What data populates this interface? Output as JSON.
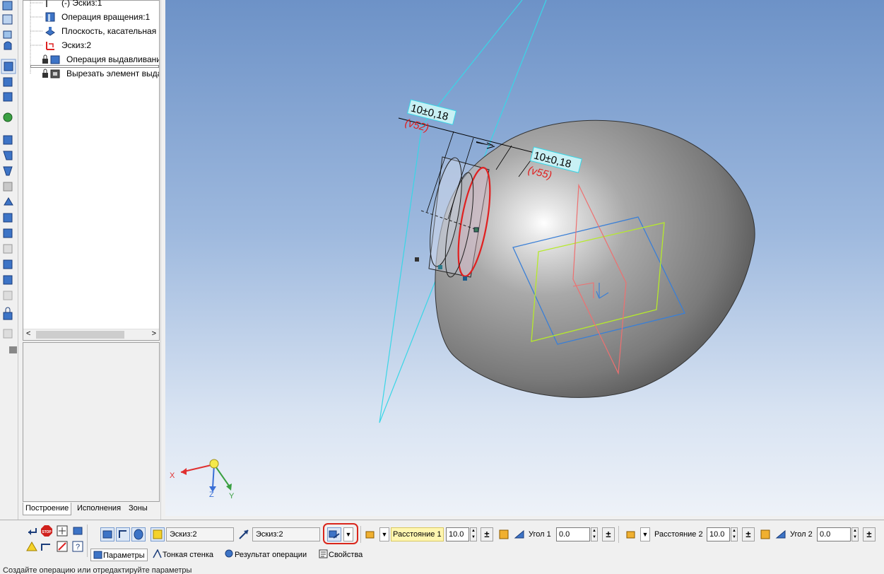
{
  "tree": {
    "items": [
      {
        "label": "(-) Эскиз:1",
        "icon": "sketch-icon"
      },
      {
        "label": "Операция вращения:1",
        "icon": "revolve-icon"
      },
      {
        "label": "Плоскость, касательная к",
        "icon": "tangent-plane-icon"
      },
      {
        "label": "Эскиз:2",
        "icon": "sketch-red-icon"
      },
      {
        "label": "Операция выдавливани",
        "icon": "extrude-icon"
      },
      {
        "label": "Вырезать элемент выда",
        "icon": "cut-extrude-icon"
      }
    ],
    "tabs": [
      "Построение",
      "Исполнения",
      "Зоны"
    ]
  },
  "viewport": {
    "dim1": {
      "value": "10±0,18",
      "var": "(v52)"
    },
    "dim2": {
      "value": "10±0,18",
      "var": "(v55)"
    },
    "axes": {
      "x": "X",
      "y": "Y",
      "z": "Z"
    }
  },
  "toolbar": {
    "sketch_field_1": "Эскиз:2",
    "sketch_field_2": "Эскиз:2",
    "distance1_label": "Расстояние 1",
    "distance1_value": "10.0",
    "angle1_label": "Угол 1",
    "angle1_value": "0.0",
    "distance2_label": "Расстояние 2",
    "distance2_value": "10.0",
    "angle2_label": "Угол 2",
    "angle2_value": "0.0",
    "stop_label": "STOP",
    "tabs": [
      "Параметры",
      "Тонкая стенка",
      "Результат операции",
      "Свойства"
    ]
  },
  "status": "Создайте операцию или отредактируйте параметры",
  "colors": {
    "accent_highlight": "#fff6b0",
    "red_ring": "#d9261c",
    "sketch_red": "#e02020",
    "plane_cyan": "#39d6e6"
  }
}
